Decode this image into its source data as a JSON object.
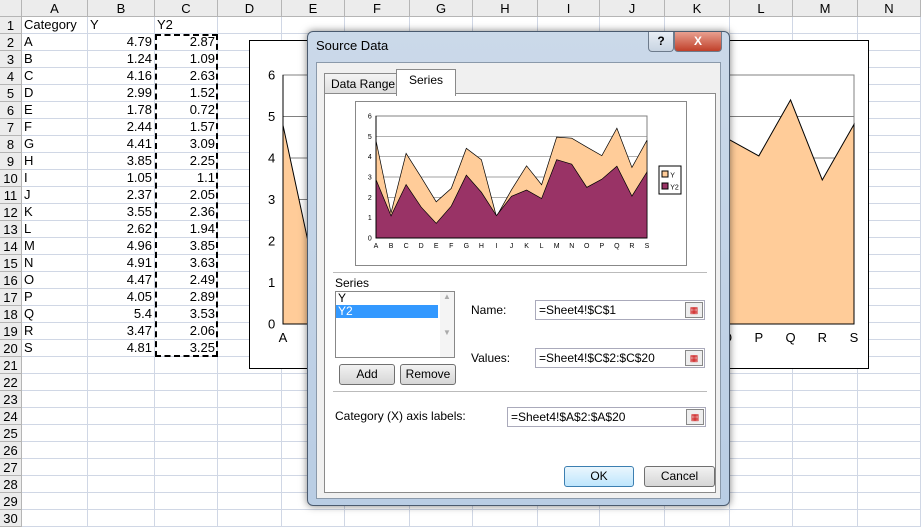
{
  "sheet": {
    "columns": [
      "A",
      "B",
      "C",
      "D",
      "E",
      "F",
      "G",
      "H",
      "I",
      "J",
      "K",
      "L",
      "M",
      "N"
    ],
    "header": [
      "Category",
      "Y",
      "Y2"
    ],
    "rows": [
      [
        "A",
        "4.79",
        "2.87"
      ],
      [
        "B",
        "1.24",
        "1.09"
      ],
      [
        "C",
        "4.16",
        "2.63"
      ],
      [
        "D",
        "2.99",
        "1.52"
      ],
      [
        "E",
        "1.78",
        "0.72"
      ],
      [
        "F",
        "2.44",
        "1.57"
      ],
      [
        "G",
        "4.41",
        "3.09"
      ],
      [
        "H",
        "3.85",
        "2.25"
      ],
      [
        "I",
        "1.05",
        "1.1"
      ],
      [
        "J",
        "2.37",
        "2.05"
      ],
      [
        "K",
        "3.55",
        "2.36"
      ],
      [
        "L",
        "2.62",
        "1.94"
      ],
      [
        "M",
        "4.96",
        "3.85"
      ],
      [
        "N",
        "4.91",
        "3.63"
      ],
      [
        "O",
        "4.47",
        "2.49"
      ],
      [
        "P",
        "4.05",
        "2.89"
      ],
      [
        "Q",
        "5.4",
        "3.53"
      ],
      [
        "R",
        "3.47",
        "2.06"
      ],
      [
        "S",
        "4.81",
        "3.25"
      ]
    ],
    "row_numbers": [
      "1",
      "2",
      "3",
      "4",
      "5",
      "6",
      "7",
      "8",
      "9",
      "10",
      "11",
      "12",
      "13",
      "14",
      "15",
      "16",
      "17",
      "18",
      "19",
      "20",
      "21",
      "22",
      "23",
      "24",
      "25",
      "26",
      "27",
      "28",
      "29",
      "30"
    ]
  },
  "chart_data": [
    {
      "type": "area",
      "categories": [
        "A",
        "B",
        "C",
        "D",
        "E",
        "F",
        "G",
        "H",
        "I",
        "J",
        "K",
        "L",
        "M",
        "N",
        "O",
        "P",
        "Q",
        "R",
        "S"
      ],
      "series": [
        {
          "name": "Y",
          "values": [
            4.79,
            1.24,
            4.16,
            2.99,
            1.78,
            2.44,
            4.41,
            3.85,
            1.05,
            2.37,
            3.55,
            2.62,
            4.96,
            4.91,
            4.47,
            4.05,
            5.4,
            3.47,
            4.81
          ],
          "color": "#ffcc99"
        }
      ],
      "ylim": [
        0,
        6
      ],
      "yticks": [
        "0",
        "1",
        "2",
        "3",
        "4",
        "5",
        "6"
      ],
      "legend": "right"
    },
    {
      "type": "area",
      "categories": [
        "A",
        "B",
        "C",
        "D",
        "E",
        "F",
        "G",
        "H",
        "I",
        "J",
        "K",
        "L",
        "M",
        "N",
        "O",
        "P",
        "Q",
        "R",
        "S"
      ],
      "series": [
        {
          "name": "Y",
          "values": [
            4.79,
            1.24,
            4.16,
            2.99,
            1.78,
            2.44,
            4.41,
            3.85,
            1.05,
            2.37,
            3.55,
            2.62,
            4.96,
            4.91,
            4.47,
            4.05,
            5.4,
            3.47,
            4.81
          ],
          "color": "#ffcc99"
        },
        {
          "name": "Y2",
          "values": [
            2.87,
            1.09,
            2.63,
            1.52,
            0.72,
            1.57,
            3.09,
            2.25,
            1.1,
            2.05,
            2.36,
            1.94,
            3.85,
            3.63,
            2.49,
            2.89,
            3.53,
            2.06,
            3.25
          ],
          "color": "#993366"
        }
      ],
      "ylim": [
        0,
        6
      ],
      "yticks": [
        "0",
        "1",
        "2",
        "3",
        "4",
        "5",
        "6"
      ],
      "legend": "right"
    }
  ],
  "dialog": {
    "title": "Source Data",
    "help": "?",
    "close": "X",
    "tabs": [
      "Data Range",
      "Series"
    ],
    "series_label": "Series",
    "series_list": [
      "Y",
      "Y2"
    ],
    "name_label": "Name:",
    "name_value": "=Sheet4!$C$1",
    "values_label": "Values:",
    "values_value": "=Sheet4!$C$2:$C$20",
    "add": "Add",
    "remove": "Remove",
    "category_label": "Category (X) axis labels:",
    "category_value": "=Sheet4!$A$2:$A$20",
    "ok": "OK",
    "cancel": "Cancel"
  }
}
